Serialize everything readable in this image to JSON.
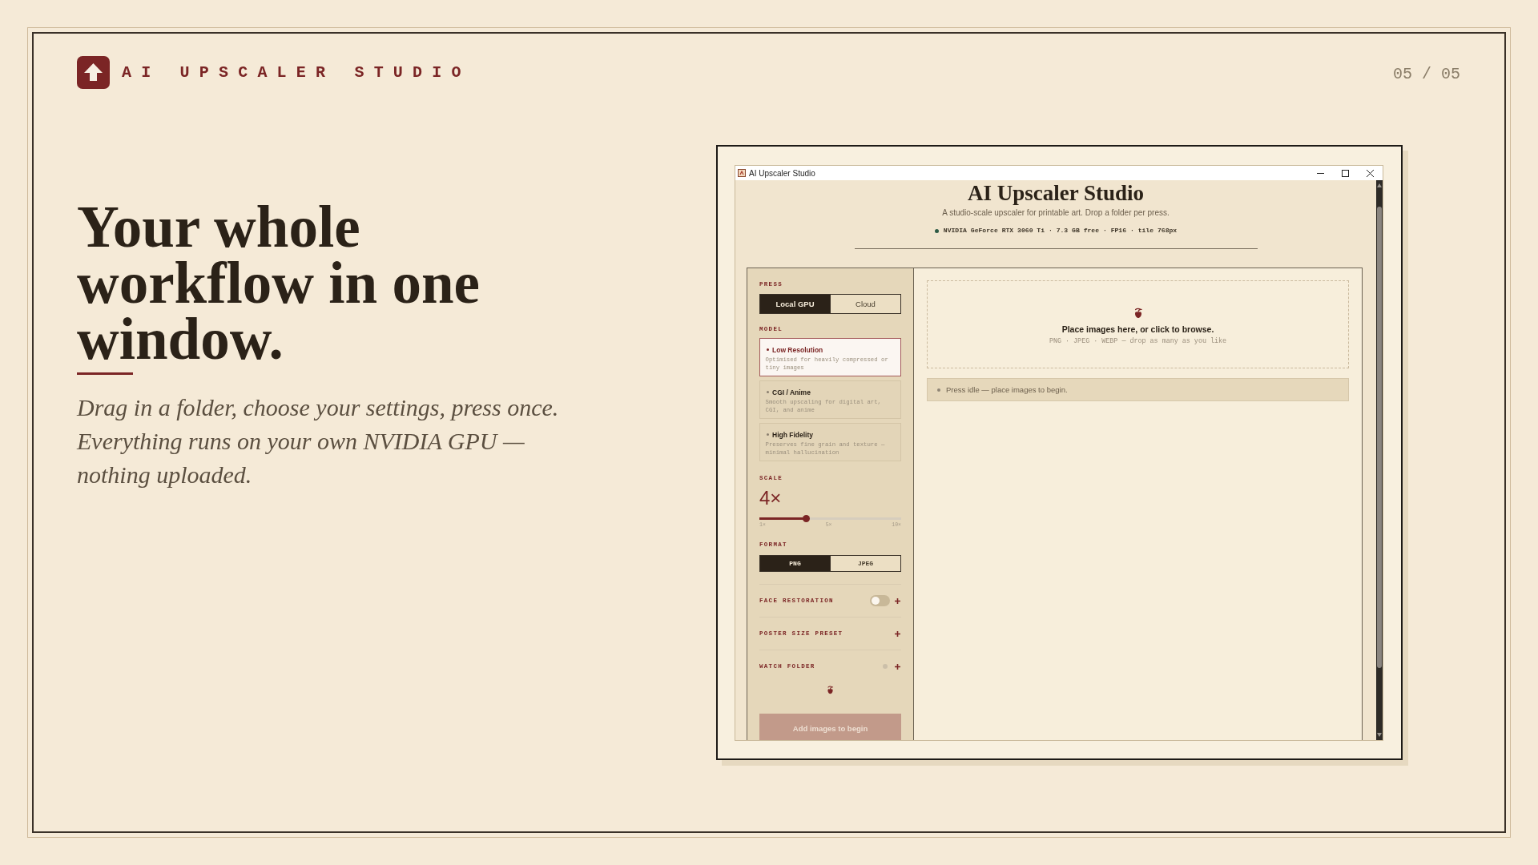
{
  "brand": {
    "name": "AI UPSCALER STUDIO"
  },
  "page_number": "05 / 05",
  "headline": "Your whole workflow in one window.",
  "subhead": "Drag in a folder, choose your settings, press once. Everything runs on your own NVIDIA GPU — nothing uploaded.",
  "app_window": {
    "title": "AI Upscaler Studio",
    "header": {
      "title": "AI Upscaler Studio",
      "subtitle": "A studio-scale upscaler for printable art. Drop a folder per press.",
      "gpu_status": {
        "text": "NVIDIA GeForce RTX 3060 Ti · 7.3 GB free · FP16 · tile 768px",
        "ready": true
      }
    },
    "sidebar": {
      "press": {
        "label": "PRESS",
        "options": [
          {
            "label": "Local GPU",
            "selected": true
          },
          {
            "label": "Cloud",
            "selected": false
          }
        ]
      },
      "model": {
        "label": "MODEL",
        "options": [
          {
            "name": "Low Resolution",
            "description": "Optimised for heavily compressed or tiny images",
            "selected": true
          },
          {
            "name": "CGI / Anime",
            "description": "Smooth upscaling for digital art, CGI, and anime",
            "selected": false
          },
          {
            "name": "High Fidelity",
            "description": "Preserves fine grain and texture — minimal hallucination",
            "selected": false
          }
        ]
      },
      "scale": {
        "label": "SCALE",
        "value": "4×",
        "level": 0.333,
        "ticks": [
          "1×",
          "5×",
          "10×"
        ]
      },
      "format": {
        "label": "FORMAT",
        "options": [
          {
            "label": "PNG",
            "selected": true
          },
          {
            "label": "JPEG",
            "selected": false
          }
        ]
      },
      "sections": [
        {
          "label": "FACE RESTORATION",
          "kind": "toggle",
          "on": false,
          "expanded": false
        },
        {
          "label": "POSTER SIZE PRESET",
          "kind": "plain",
          "expanded": false
        },
        {
          "label": "WATCH FOLDER",
          "kind": "indicator",
          "on": false,
          "expanded": false
        }
      ],
      "action_button": {
        "label": "Add images to begin",
        "disabled": true
      }
    },
    "drop_zone": {
      "title": "Place images here, or click to browse.",
      "hint": "PNG · JPEG · WEBP — drop as many as you like"
    },
    "status": {
      "text": "Press idle — place images to begin.",
      "active": false
    }
  }
}
